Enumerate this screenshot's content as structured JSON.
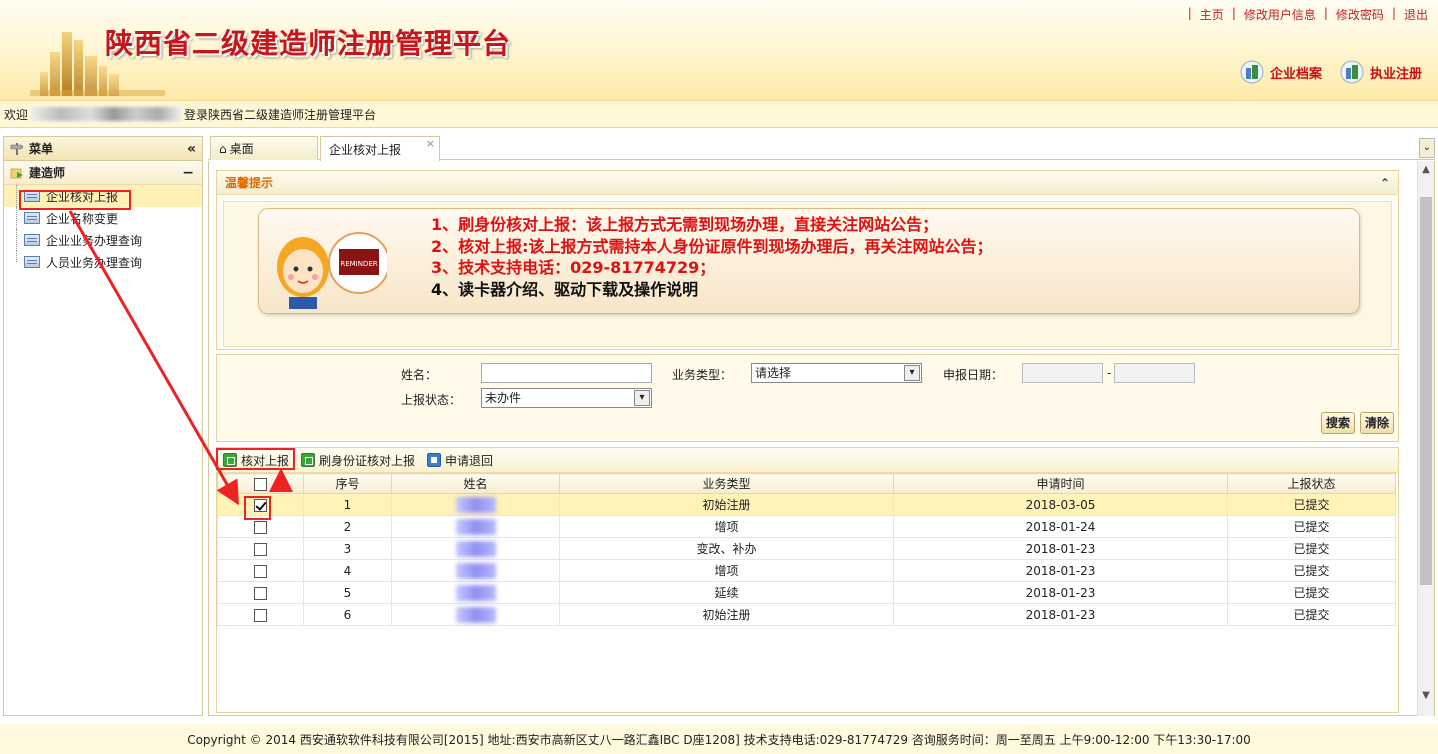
{
  "header": {
    "title": "陕西省二级建造师注册管理平台",
    "top_links": [
      "主页",
      "修改用户信息",
      "修改密码",
      "退出"
    ],
    "quick_buttons": [
      "企业档案",
      "执业注册"
    ]
  },
  "welcome": {
    "prefix": "欢迎",
    "suffix": "登录陕西省二级建造师注册管理平台"
  },
  "sidebar": {
    "menu_title": "菜单",
    "collapse_icon": "«",
    "group_title": "建造师",
    "group_toggle": "−",
    "items": [
      {
        "label": "企业核对上报"
      },
      {
        "label": "企业名称变更"
      },
      {
        "label": "企业业务办理查询"
      },
      {
        "label": "人员业务办理查询"
      }
    ]
  },
  "tabs": {
    "home": "桌面",
    "active": "企业核对上报",
    "close": "×"
  },
  "reminder": {
    "title": "温馨提示",
    "toggle": "⌃",
    "lines": [
      "1、刷身份核对上报：该上报方式无需到现场办理，直接关注网站公告；",
      "2、核对上报:该上报方式需持本人身份证原件到现场办理后，再关注网站公告；",
      "3、技术支持电话：029-81774729；",
      "4、读卡器介绍、驱动下载及操作说明"
    ],
    "stamp_text": "REMINDER"
  },
  "search": {
    "name_label": "姓名：",
    "name_value": "",
    "biz_type_label": "业务类型：",
    "biz_type_value": "请选择",
    "date_label": "申报日期：",
    "date_sep": "-",
    "status_label": "上报状态：",
    "status_value": "未办件",
    "search_btn": "搜索",
    "clear_btn": "清除"
  },
  "grid": {
    "toolbar": [
      "核对上报",
      "刷身份证核对上报",
      "申请退回"
    ],
    "columns": [
      "序号",
      "姓名",
      "业务类型",
      "申请时间",
      "上报状态"
    ],
    "rows": [
      {
        "no": "1",
        "type": "初始注册",
        "date": "2018-03-05",
        "status": "已提交",
        "checked": true
      },
      {
        "no": "2",
        "type": "增项",
        "date": "2018-01-24",
        "status": "已提交",
        "checked": false
      },
      {
        "no": "3",
        "type": "变改、补办",
        "date": "2018-01-23",
        "status": "已提交",
        "checked": false
      },
      {
        "no": "4",
        "type": "增项",
        "date": "2018-01-23",
        "status": "已提交",
        "checked": false
      },
      {
        "no": "5",
        "type": "延续",
        "date": "2018-01-23",
        "status": "已提交",
        "checked": false
      },
      {
        "no": "6",
        "type": "初始注册",
        "date": "2018-01-23",
        "status": "已提交",
        "checked": false
      }
    ]
  },
  "footer": {
    "text": "Copyright © 2014   西安通软软件科技有限公司[2015]   地址:西安市高新区丈八一路汇鑫IBC D座1208]   技术支持电话:029-81774729 咨询服务时间：周一至周五 上午9:00-12:00 下午13:30-17:00"
  },
  "colors": {
    "brand_red": "#c8141b",
    "accent_orange": "#e06a00",
    "annotation_red": "#e22222"
  }
}
